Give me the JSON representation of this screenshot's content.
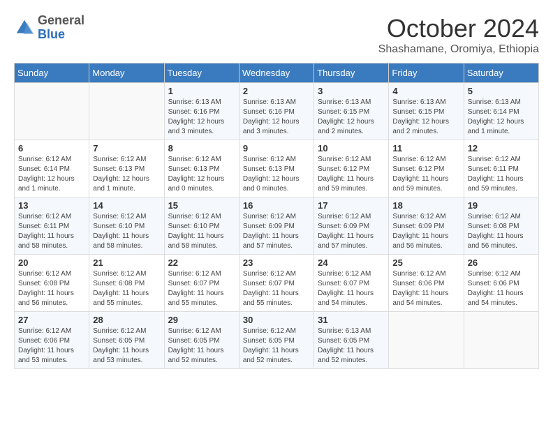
{
  "header": {
    "logo_general": "General",
    "logo_blue": "Blue",
    "month_title": "October 2024",
    "location": "Shashamane, Oromiya, Ethiopia"
  },
  "calendar": {
    "days_of_week": [
      "Sunday",
      "Monday",
      "Tuesday",
      "Wednesday",
      "Thursday",
      "Friday",
      "Saturday"
    ],
    "weeks": [
      [
        {
          "day": "",
          "info": ""
        },
        {
          "day": "",
          "info": ""
        },
        {
          "day": "1",
          "info": "Sunrise: 6:13 AM\nSunset: 6:16 PM\nDaylight: 12 hours and 3 minutes."
        },
        {
          "day": "2",
          "info": "Sunrise: 6:13 AM\nSunset: 6:16 PM\nDaylight: 12 hours and 3 minutes."
        },
        {
          "day": "3",
          "info": "Sunrise: 6:13 AM\nSunset: 6:15 PM\nDaylight: 12 hours and 2 minutes."
        },
        {
          "day": "4",
          "info": "Sunrise: 6:13 AM\nSunset: 6:15 PM\nDaylight: 12 hours and 2 minutes."
        },
        {
          "day": "5",
          "info": "Sunrise: 6:13 AM\nSunset: 6:14 PM\nDaylight: 12 hours and 1 minute."
        }
      ],
      [
        {
          "day": "6",
          "info": "Sunrise: 6:12 AM\nSunset: 6:14 PM\nDaylight: 12 hours and 1 minute."
        },
        {
          "day": "7",
          "info": "Sunrise: 6:12 AM\nSunset: 6:13 PM\nDaylight: 12 hours and 1 minute."
        },
        {
          "day": "8",
          "info": "Sunrise: 6:12 AM\nSunset: 6:13 PM\nDaylight: 12 hours and 0 minutes."
        },
        {
          "day": "9",
          "info": "Sunrise: 6:12 AM\nSunset: 6:13 PM\nDaylight: 12 hours and 0 minutes."
        },
        {
          "day": "10",
          "info": "Sunrise: 6:12 AM\nSunset: 6:12 PM\nDaylight: 11 hours and 59 minutes."
        },
        {
          "day": "11",
          "info": "Sunrise: 6:12 AM\nSunset: 6:12 PM\nDaylight: 11 hours and 59 minutes."
        },
        {
          "day": "12",
          "info": "Sunrise: 6:12 AM\nSunset: 6:11 PM\nDaylight: 11 hours and 59 minutes."
        }
      ],
      [
        {
          "day": "13",
          "info": "Sunrise: 6:12 AM\nSunset: 6:11 PM\nDaylight: 11 hours and 58 minutes."
        },
        {
          "day": "14",
          "info": "Sunrise: 6:12 AM\nSunset: 6:10 PM\nDaylight: 11 hours and 58 minutes."
        },
        {
          "day": "15",
          "info": "Sunrise: 6:12 AM\nSunset: 6:10 PM\nDaylight: 11 hours and 58 minutes."
        },
        {
          "day": "16",
          "info": "Sunrise: 6:12 AM\nSunset: 6:09 PM\nDaylight: 11 hours and 57 minutes."
        },
        {
          "day": "17",
          "info": "Sunrise: 6:12 AM\nSunset: 6:09 PM\nDaylight: 11 hours and 57 minutes."
        },
        {
          "day": "18",
          "info": "Sunrise: 6:12 AM\nSunset: 6:09 PM\nDaylight: 11 hours and 56 minutes."
        },
        {
          "day": "19",
          "info": "Sunrise: 6:12 AM\nSunset: 6:08 PM\nDaylight: 11 hours and 56 minutes."
        }
      ],
      [
        {
          "day": "20",
          "info": "Sunrise: 6:12 AM\nSunset: 6:08 PM\nDaylight: 11 hours and 56 minutes."
        },
        {
          "day": "21",
          "info": "Sunrise: 6:12 AM\nSunset: 6:08 PM\nDaylight: 11 hours and 55 minutes."
        },
        {
          "day": "22",
          "info": "Sunrise: 6:12 AM\nSunset: 6:07 PM\nDaylight: 11 hours and 55 minutes."
        },
        {
          "day": "23",
          "info": "Sunrise: 6:12 AM\nSunset: 6:07 PM\nDaylight: 11 hours and 55 minutes."
        },
        {
          "day": "24",
          "info": "Sunrise: 6:12 AM\nSunset: 6:07 PM\nDaylight: 11 hours and 54 minutes."
        },
        {
          "day": "25",
          "info": "Sunrise: 6:12 AM\nSunset: 6:06 PM\nDaylight: 11 hours and 54 minutes."
        },
        {
          "day": "26",
          "info": "Sunrise: 6:12 AM\nSunset: 6:06 PM\nDaylight: 11 hours and 54 minutes."
        }
      ],
      [
        {
          "day": "27",
          "info": "Sunrise: 6:12 AM\nSunset: 6:06 PM\nDaylight: 11 hours and 53 minutes."
        },
        {
          "day": "28",
          "info": "Sunrise: 6:12 AM\nSunset: 6:05 PM\nDaylight: 11 hours and 53 minutes."
        },
        {
          "day": "29",
          "info": "Sunrise: 6:12 AM\nSunset: 6:05 PM\nDaylight: 11 hours and 52 minutes."
        },
        {
          "day": "30",
          "info": "Sunrise: 6:12 AM\nSunset: 6:05 PM\nDaylight: 11 hours and 52 minutes."
        },
        {
          "day": "31",
          "info": "Sunrise: 6:13 AM\nSunset: 6:05 PM\nDaylight: 11 hours and 52 minutes."
        },
        {
          "day": "",
          "info": ""
        },
        {
          "day": "",
          "info": ""
        }
      ]
    ]
  }
}
